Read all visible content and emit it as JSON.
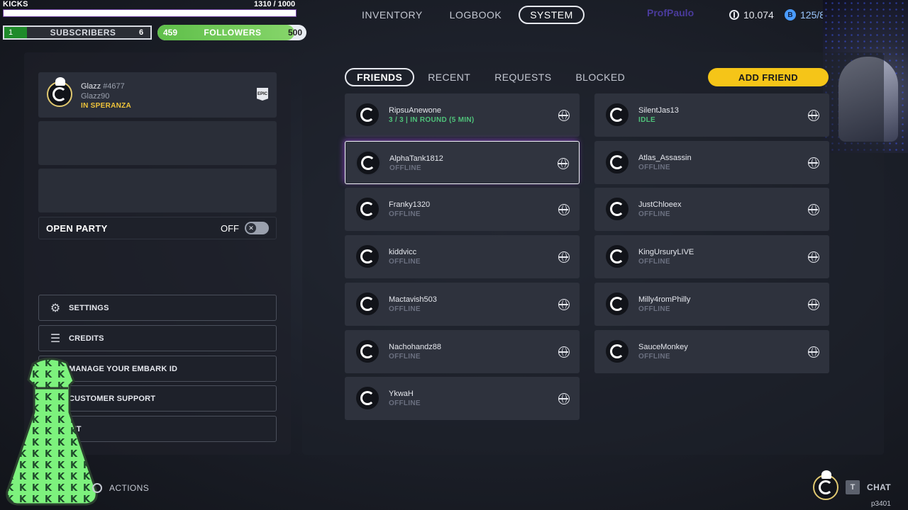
{
  "overlay": {
    "kicks_label": "KICKS",
    "kicks_count": "1310 / 1000",
    "kicks_progress": 1.0,
    "subscribers_current": "1",
    "subscribers_label": "SUBSCRIBERS",
    "subscribers_goal": "6",
    "followers_current": "459",
    "followers_label": "FOLLOWERS",
    "followers_goal": "500",
    "followers_progress": 0.918
  },
  "topnav": {
    "tabs": [
      {
        "label": "INVENTORY"
      },
      {
        "label": "LOGBOOK"
      },
      {
        "label": "SYSTEM",
        "active": true
      }
    ],
    "streamer_tag": "ProfPaulo",
    "currency1": "10.074",
    "currency2": "125/8"
  },
  "profile": {
    "name": "Glazz",
    "tag": "#4677",
    "handle": "Glazz90",
    "location": "IN SPERANZA",
    "platform_icon": "epic-games-icon"
  },
  "open_party": {
    "label": "OPEN PARTY",
    "state": "OFF"
  },
  "menu": [
    {
      "label": "SETTINGS",
      "icon": "gear-icon"
    },
    {
      "label": "CREDITS",
      "icon": "credits-icon"
    },
    {
      "label": "MANAGE YOUR EMBARK ID",
      "icon": "id-icon"
    },
    {
      "label": "CUSTOMER SUPPORT",
      "icon": "support-icon"
    },
    {
      "label": "EXIT",
      "display": "XIT",
      "icon": "exit-icon"
    }
  ],
  "actions_label": "ACTIONS",
  "friends_tabs": [
    {
      "label": "FRIENDS",
      "active": true
    },
    {
      "label": "RECENT"
    },
    {
      "label": "REQUESTS"
    },
    {
      "label": "BLOCKED"
    }
  ],
  "add_friend_label": "ADD FRIEND",
  "friends": [
    {
      "name": "RipsuAnewone",
      "status": "3 / 3 | IN ROUND (5 MIN)",
      "online": true
    },
    {
      "name": "SilentJas13",
      "status": "IDLE",
      "online": true
    },
    {
      "name": "AlphaTank1812",
      "status": "OFFLINE",
      "selected": true
    },
    {
      "name": "Atlas_Assassin",
      "status": "OFFLINE"
    },
    {
      "name": "Franky1320",
      "status": "OFFLINE"
    },
    {
      "name": "JustChloeex",
      "status": "OFFLINE"
    },
    {
      "name": "kiddvicc",
      "status": "OFFLINE"
    },
    {
      "name": "KingUrsuryLIVE",
      "status": "OFFLINE"
    },
    {
      "name": "Mactavish503",
      "status": "OFFLINE"
    },
    {
      "name": "Milly4romPhilly",
      "status": "OFFLINE"
    },
    {
      "name": "Nachohandz88",
      "status": "OFFLINE"
    },
    {
      "name": "SauceMonkey",
      "status": "OFFLINE"
    },
    {
      "name": "YkwaH",
      "status": "OFFLINE"
    }
  ],
  "chat": {
    "key": "T",
    "label": "CHAT"
  },
  "build": "p3401"
}
